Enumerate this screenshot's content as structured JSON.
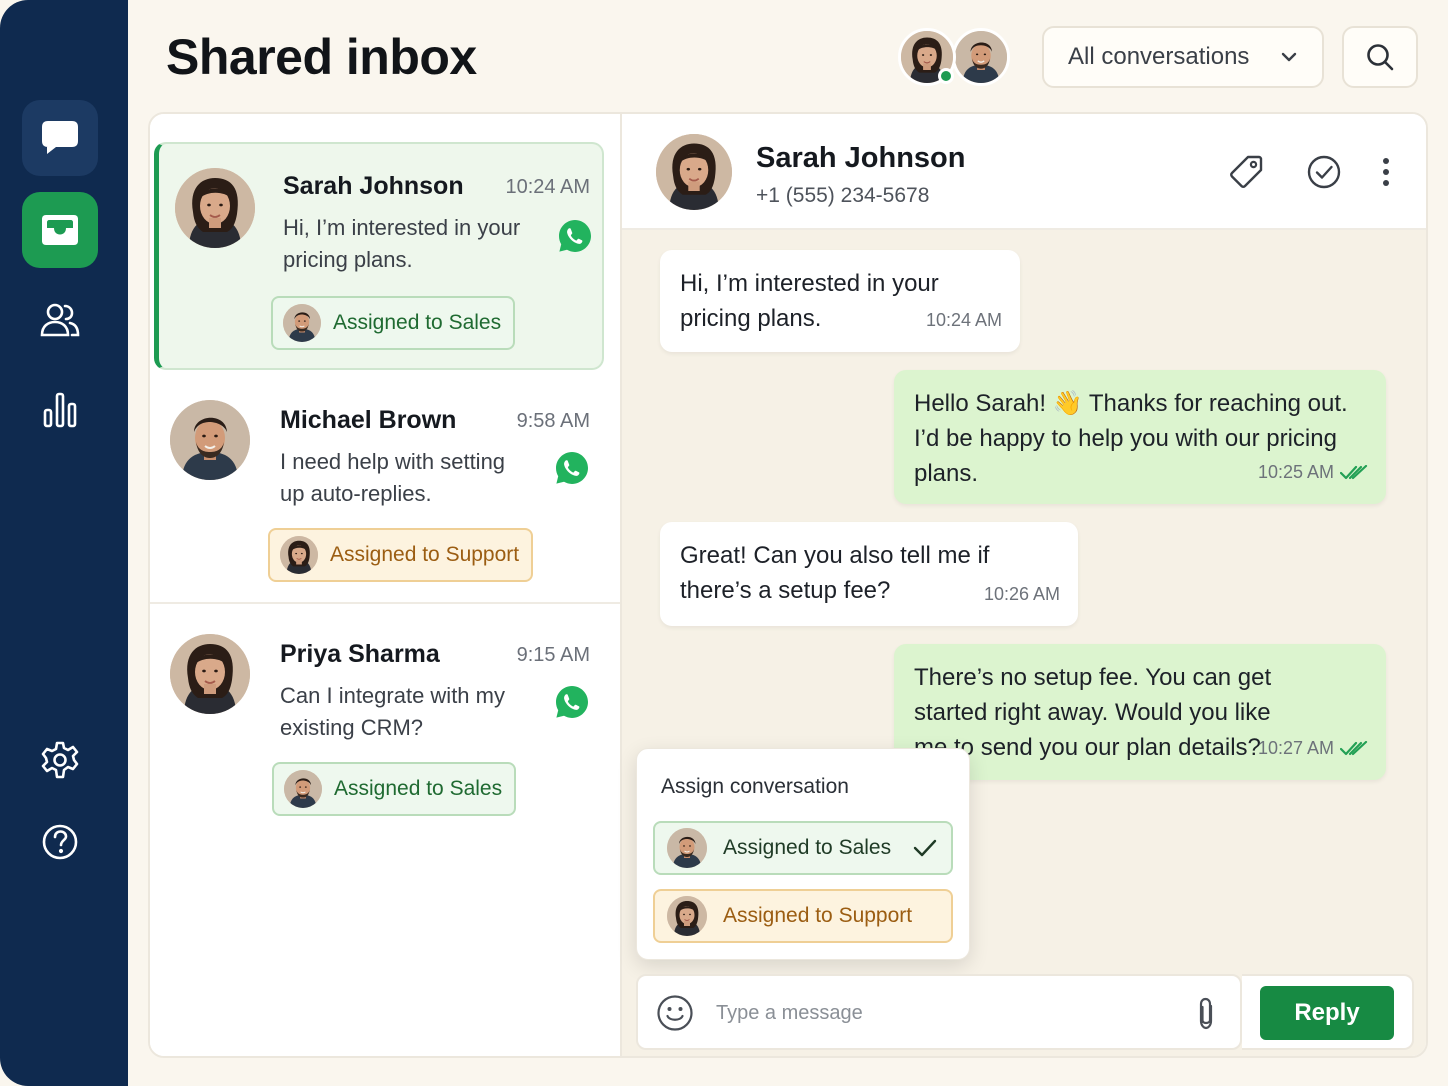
{
  "page": {
    "title": "Shared inbox"
  },
  "header": {
    "filter_label": "All conversations",
    "accent_color": "#1d9b52"
  },
  "sidebar": {
    "items": [
      {
        "icon": "chat-bubble-icon",
        "active": false
      },
      {
        "icon": "inbox-icon",
        "active": true
      },
      {
        "icon": "users-icon",
        "active": false
      },
      {
        "icon": "bar-chart-icon",
        "active": false
      },
      {
        "icon": "settings-gear-icon",
        "active": false
      },
      {
        "icon": "help-icon",
        "active": false
      }
    ]
  },
  "conversations": [
    {
      "name": "Sarah Johnson",
      "time": "10:24 AM",
      "preview": "Hi, I’m interested in your pricing plans.",
      "channel": "whatsapp-icon",
      "assignment": "Assigned to Sales",
      "selected": true
    },
    {
      "name": "Michael Brown",
      "time": "9:58 AM",
      "preview": "I need help with setting up auto-replies.",
      "channel": "whatsapp-icon",
      "assignment": "Assigned to Support",
      "selected": false
    },
    {
      "name": "Priya Sharma",
      "time": "9:15 AM",
      "preview": "Can I integrate with my existing CRM?",
      "channel": "whatsapp-icon",
      "assignment": "Assigned to Sales",
      "selected": false
    }
  ],
  "chat": {
    "contact_name": "Sarah Johnson",
    "contact_phone": "+1 (555) 234-5678",
    "messages": [
      {
        "direction": "in",
        "text": "Hi, I’m interested in your pricing plans.",
        "time": "10:24 AM"
      },
      {
        "direction": "out",
        "text": "Hello Sarah! 👋 Thanks for reaching out. I’d be happy to help you with our pricing plans.",
        "time": "10:25 AM",
        "status": "read"
      },
      {
        "direction": "in",
        "text": "Great! Can you also tell me if there’s a setup fee?",
        "time": "10:26 AM"
      },
      {
        "direction": "out",
        "text": "There’s no setup fee. You can get started right away. Would you like me to send you our plan details?",
        "time": "10:27 AM",
        "status": "read"
      }
    ]
  },
  "assign_popover": {
    "title": "Assign conversation",
    "options": [
      {
        "label": "Assigned to Sales",
        "selected": true
      },
      {
        "label": "Assigned to Support",
        "selected": false
      }
    ]
  },
  "composer": {
    "placeholder": "Type a message",
    "value": "",
    "reply_label": "Reply"
  }
}
